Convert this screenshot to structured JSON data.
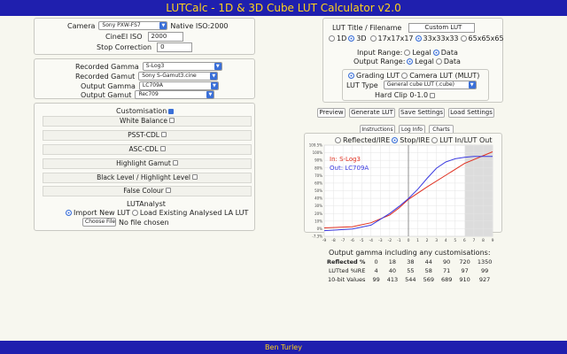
{
  "header": {
    "title": "LUTCalc - 1D & 3D Cube LUT Calculator v2.0"
  },
  "footer": {
    "author": "Ben Turley"
  },
  "camera": {
    "camera_label": "Camera",
    "camera_value": "Sony PXW-FS7",
    "native_iso": "Native ISO:2000",
    "cinei_label": "CineEI ISO",
    "cinei_value": "2000",
    "stop_label": "Stop Correction",
    "stop_value": "0"
  },
  "gamma": {
    "rec_gamma_label": "Recorded Gamma",
    "rec_gamma_value": "S-Log3",
    "rec_gamut_label": "Recorded Gamut",
    "rec_gamut_value": "Sony S-Gamut3.cine",
    "out_gamma_label": "Output Gamma",
    "out_gamma_value": "LC709A",
    "out_gamut_label": "Output Gamut",
    "out_gamut_value": "Rec709"
  },
  "custom": {
    "customisation": "Customisation",
    "items": [
      "White Balance",
      "PSST-CDL",
      "ASC-CDL",
      "Highlight Gamut",
      "Black Level / Highlight Level",
      "False Colour"
    ],
    "lutanalyst": "LUTAnalyst",
    "import_new": "Import New LUT",
    "load_existing": "Load Existing Analysed LA LUT",
    "choose_file": "Choose File",
    "no_file": "No file chosen"
  },
  "lut": {
    "title_label": "LUT Title / Filename",
    "title_value": "Custom LUT",
    "dims": [
      "1D",
      "3D",
      "17x17x17",
      "33x33x33",
      "65x65x65"
    ],
    "input_range": "Input Range:",
    "output_range": "Output Range:",
    "legal": "Legal",
    "data": "Data",
    "grading": "Grading LUT",
    "camera_mlut": "Camera LUT (MLUT)",
    "type_label": "LUT Type",
    "type_value": "General cube LUT (.cube)",
    "hardclip": "Hard Clip 0-1.0"
  },
  "actions": {
    "preview": "Preview",
    "generate": "Generate LUT",
    "save": "Save Settings",
    "load": "Load Settings"
  },
  "tabs": {
    "instructions": "Instructions",
    "loginfo": "Log Info",
    "charts": "Charts"
  },
  "chart_opts": {
    "reflected": "Reflected/IRE",
    "stop": "Stop/IRE",
    "lutin": "LUT In/LUT Out"
  },
  "chart_data": {
    "type": "line",
    "in_label": "In: S-Log3",
    "out_label": "Out: LC709A",
    "y_ticks": [
      "109.5%",
      "100%",
      "90%",
      "80%",
      "70%",
      "60%",
      "50%",
      "40%",
      "30%",
      "20%",
      "10%",
      "0%",
      "-7.3%"
    ],
    "x_ticks": [
      "-9",
      "-8",
      "-7",
      "-6",
      "-5",
      "-4",
      "-3",
      "-2",
      "-1",
      "0",
      "1",
      "2",
      "3",
      "4",
      "5",
      "6",
      "7",
      "8",
      "9"
    ],
    "xlim": [
      -9,
      9
    ],
    "ylim": [
      -7.3,
      109.5
    ],
    "series": [
      {
        "color": "#e03020",
        "x": [
          -9,
          -6,
          -4,
          -2,
          -1,
          0,
          2,
          4,
          6,
          9
        ],
        "y": [
          3.5,
          5,
          10,
          20,
          29,
          40,
          56,
          71,
          86,
          101
        ]
      },
      {
        "color": "#3a3ae0",
        "x": [
          -9,
          -6,
          -4,
          -2,
          -1,
          0,
          1,
          2,
          3,
          4,
          5,
          6,
          7,
          9
        ],
        "y": [
          0,
          2,
          7,
          22,
          31,
          41,
          53,
          67,
          80,
          88,
          92,
          94,
          95,
          95
        ]
      }
    ]
  },
  "table": {
    "title": "Output gamma including any customisations:",
    "rows": [
      [
        "Reflected %",
        "0",
        "18",
        "38",
        "44",
        "90",
        "720",
        "1350"
      ],
      [
        "LUTted %IRE",
        "4",
        "40",
        "55",
        "58",
        "71",
        "97",
        "99"
      ],
      [
        "10-bit Values",
        "99",
        "413",
        "544",
        "569",
        "689",
        "910",
        "927"
      ]
    ]
  },
  "colors": {
    "bar": "#1f1fae",
    "bar_text": "#ffd21a",
    "accent": "#3a6fd8"
  }
}
